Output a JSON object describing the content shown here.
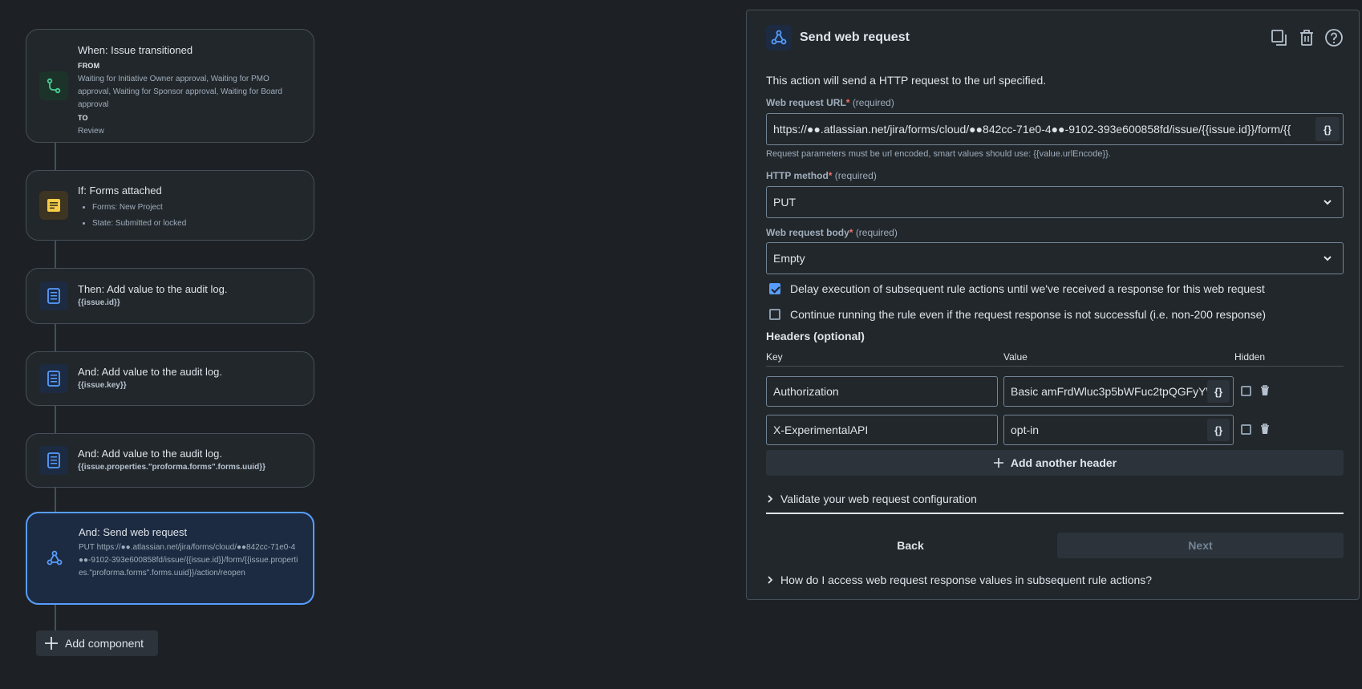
{
  "flow": {
    "trigger": {
      "title": "When: Issue transitioned",
      "from_label": "FROM",
      "from_value": "Waiting for Initiative Owner approval, Waiting for PMO approval, Waiting for Sponsor approval, Waiting for Board approval",
      "to_label": "TO",
      "to_value": "Review"
    },
    "condition": {
      "title": "If: Forms attached",
      "items": [
        "Forms: New Project",
        "State: Submitted or locked"
      ]
    },
    "actions": [
      {
        "title": "Then: Add value to the audit log.",
        "value": "{{issue.id}}"
      },
      {
        "title": "And: Add value to the audit log.",
        "value": "{{issue.key}}"
      },
      {
        "title": "And: Add value to the audit log.",
        "value": "{{issue.properties.\"proforma.forms\".forms.uuid}}"
      }
    ],
    "web_request": {
      "title": "And: Send web request",
      "detail": "PUT https://●●.atlassian.net/jira/forms/cloud/●●842cc-71e0-4●●-9102-393e600858fd/issue/{{issue.id}}/form/{{issue.properties.\"proforma.forms\".forms.uuid}}/action/reopen"
    },
    "add_component": "Add component"
  },
  "panel": {
    "title": "Send web request",
    "description": "This action will send a HTTP request to the url specified.",
    "url_label": "Web request URL",
    "required_star": "*",
    "required_text": "(required)",
    "url_value": "https://●●.atlassian.net/jira/forms/cloud/●●842cc-71e0-4●●-9102-393e600858fd/issue/{{issue.id}}/form/{{",
    "brace": "{}",
    "url_helper": "Request parameters must be url encoded, smart values should use: {{value.urlEncode}}.",
    "method_label": "HTTP method",
    "method_value": "PUT",
    "body_label": "Web request body",
    "body_value": "Empty",
    "delay_label": "Delay execution of subsequent rule actions until we've received a response for this web request",
    "delay_checked": true,
    "continue_label": "Continue running the rule even if the request response is not successful (i.e. non-200 response)",
    "continue_checked": false,
    "headers_title": "Headers (optional)",
    "col_key": "Key",
    "col_value": "Value",
    "col_hidden": "Hidden",
    "headers": [
      {
        "key": "Authorization",
        "value": "Basic amFrdWluc3p5bWFuc2tpQGFyYW"
      },
      {
        "key": "X-ExperimentalAPI",
        "value": "opt-in"
      }
    ],
    "add_header": "Add another header",
    "validate": "Validate your web request configuration",
    "back": "Back",
    "next": "Next",
    "faq": "How do I access web request response values in subsequent rule actions?"
  },
  "colors": {
    "accent": "#579dff",
    "background": "#1d2125",
    "surface": "#22272b"
  }
}
